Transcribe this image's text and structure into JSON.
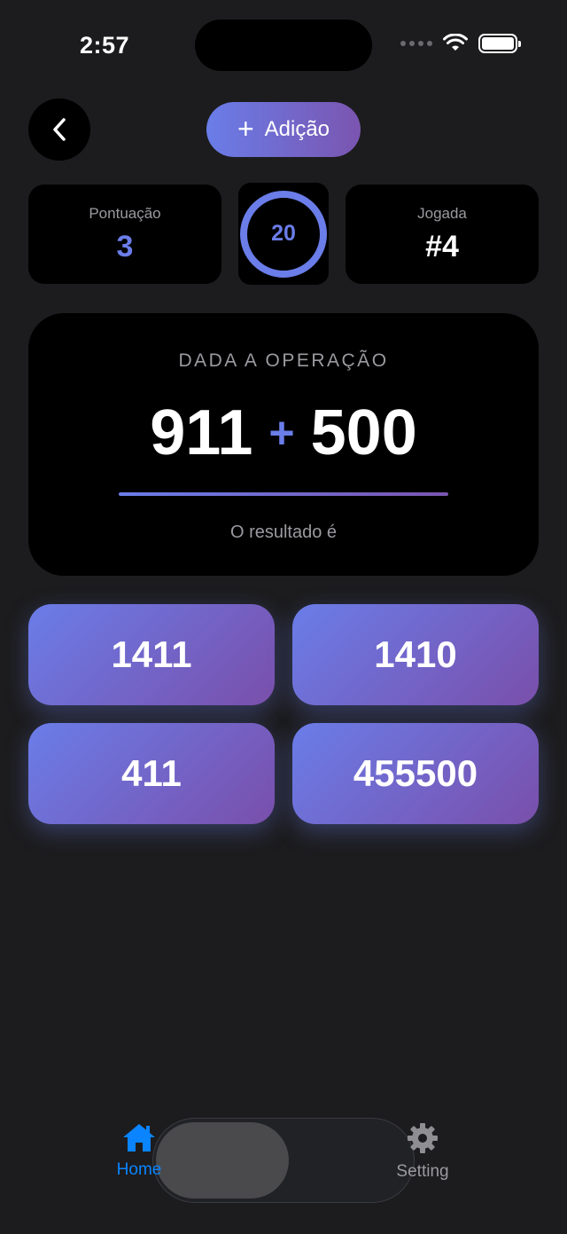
{
  "status_bar": {
    "time": "2:57"
  },
  "header": {
    "operation_label": "Adição"
  },
  "stats": {
    "score_label": "Pontuação",
    "score_value": "3",
    "timer_value": "20",
    "round_label": "Jogada",
    "round_value": "#4"
  },
  "operation": {
    "caption": "DADA A OPERAÇÃO",
    "operand_a": "911",
    "operator": "+",
    "operand_b": "500",
    "result_label": "O resultado é"
  },
  "answers": [
    "1411",
    "1410",
    "411",
    "455500"
  ],
  "tabbar": {
    "home_label": "Home",
    "setting_label": "Setting"
  },
  "colors": {
    "accent": "#6a7de8",
    "gradient_end": "#7a55b0",
    "tab_active": "#0a84ff",
    "background": "#1c1c1e"
  }
}
